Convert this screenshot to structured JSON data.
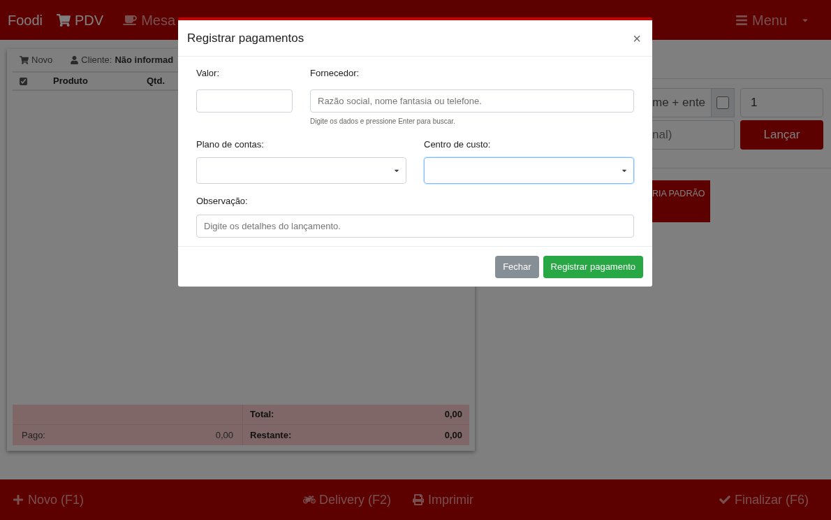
{
  "navbar": {
    "brand": "Foodi",
    "items": [
      {
        "label": "PDV"
      },
      {
        "label": "Mesa"
      }
    ],
    "menu": {
      "label": "Menu"
    }
  },
  "order": {
    "toolbar": {
      "new_label": "Novo",
      "client_label": "Cliente:",
      "client_value": "Não informad"
    },
    "select_all_checked": true,
    "columns": [
      "Produto",
      "Qtd."
    ],
    "totals": {
      "total_label": "Total:",
      "total_value": "0,00",
      "paid_label": "Pago:",
      "paid_value": "0,00",
      "remaining_label": "Restante:",
      "remaining_value": "0,00"
    }
  },
  "entry": {
    "search_value": "me + ente",
    "checkbox_checked": false,
    "quantity": "1",
    "note_value": "nal)",
    "submit": "Lançar",
    "category": "RIA PADRÃO"
  },
  "modal": {
    "title": "Registrar pagamentos",
    "close": "×",
    "valor": {
      "label": "Valor:"
    },
    "fornecedor": {
      "label": "Fornecedor:",
      "placeholder": "Razão social, nome fantasia ou telefone.",
      "help": "Digite os dados e pressione Enter para buscar."
    },
    "plano": {
      "label": "Plano de contas:",
      "focused": false
    },
    "centro": {
      "label": "Centro de custo:",
      "focused": true
    },
    "observacao": {
      "label": "Observação:",
      "placeholder": "Digite os detalhes do lançamento."
    },
    "buttons": [
      {
        "kind": "secondary",
        "label": "Fechar"
      },
      {
        "kind": "success",
        "label": "Registrar pagamento"
      }
    ]
  },
  "footer": {
    "items": [
      {
        "label": "Novo (F1)"
      },
      {
        "label": "Delivery (F2)"
      },
      {
        "label": "Imprimir"
      },
      {
        "label": "Finalizar (F6)"
      }
    ]
  }
}
